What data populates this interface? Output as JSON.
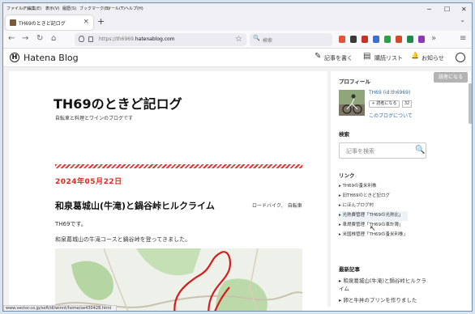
{
  "menubar": {
    "items": [
      "ファイル(F)",
      "編集(E)",
      "表示(V)",
      "履歴(S)",
      "ブックマーク(B)",
      "ツール(T)",
      "ヘルプ(H)"
    ],
    "minimize": "─",
    "maximize": "☐",
    "close": "✕"
  },
  "tab": {
    "title": "TH69のときど記ログ",
    "close": "×"
  },
  "tabbar": {
    "new_tab": "+",
    "list": "⌄"
  },
  "nav": {
    "back": "←",
    "forward": "→",
    "reload": "↻",
    "home": "⌂",
    "url_prefix": "https://th6969.",
    "url_domain": "hatenablog.com",
    "bookmark_star": "☆",
    "search_icon": "🔍",
    "search_placeholder": "検索",
    "more": "»",
    "menu": "≡"
  },
  "header": {
    "logo": "Hatena Blog",
    "logo_mark": "H",
    "write_icon": "✎",
    "write": "記事を書く",
    "reading_icon": "▤",
    "reading": "購読リスト",
    "notify_icon": "🔔",
    "notify": "お知らせ"
  },
  "readers_top": "読者になる",
  "main": {
    "title": "TH69のときど記ログ",
    "desc": "自転車と料理とワインのブログです",
    "post": {
      "date": "2024年05月22日",
      "title": "和泉葛城山(牛滝)と鍋谷峠ヒルクライム",
      "categories": "ロードバイク,　自転車",
      "p1": "TH69です。",
      "p2": "和泉葛城山の牛滝コースと鍋谷峠を登ってきました。"
    }
  },
  "sidebar": {
    "profile_heading": "プロフィール",
    "profile_name": "TH69 (id:th6969)",
    "readers_btn": "+ 読者になる",
    "readers_count": "32",
    "about": "このブログについて",
    "search_heading": "検索",
    "search_placeholder": "記事を検索",
    "search_icon": "🔍",
    "links_heading": "リンク",
    "links": [
      "▸ TH69の蚤米利株",
      "▸ 旧TH69のときど記ログ",
      "▸ にほんブログ村",
      "▸ 光熱費管理「TH69の光熱比」",
      "▸ 車燃費管理「TH69の車計簿」",
      "▸ 米国株管理「TH69の蚤米利株」"
    ],
    "recent_heading": "最新記事",
    "recent": [
      "▸ 和泉葛城山(牛滝)と鍋谷峠ヒルクライム",
      "▸ 卵と牛丼のプリンを作りました"
    ]
  },
  "status_url": "www.vector.co.jp/soft/dl/winnt/home/se430428.html",
  "cursor": "↖",
  "colors": {
    "accent": "#e0281e",
    "link": "#2a6ab8"
  }
}
